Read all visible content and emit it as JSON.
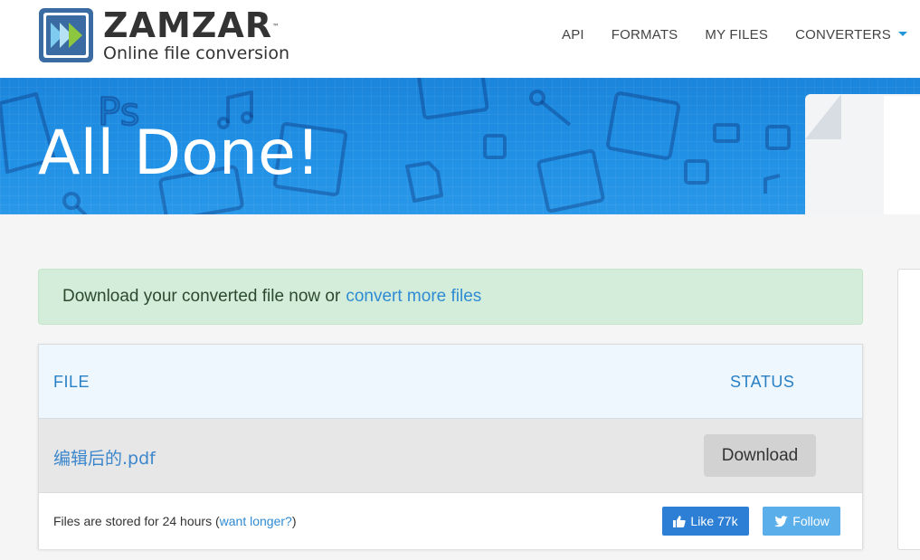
{
  "brand": {
    "name": "ZAMZAR",
    "trademark": "™",
    "tagline": "Online file conversion",
    "colors": {
      "badge_bg": "#3a6ca3",
      "arrow_light": "#7ecbef",
      "arrow_green": "#8dc63f"
    }
  },
  "nav": {
    "items": [
      {
        "label": "API"
      },
      {
        "label": "FORMATS"
      },
      {
        "label": "MY FILES"
      },
      {
        "label": "CONVERTERS"
      }
    ],
    "dropdown_icon": "caret-down-icon"
  },
  "banner": {
    "title": "All Done!",
    "bg_color": "#1e8ce0"
  },
  "alert": {
    "text": "Download your converted file now or",
    "link": "convert more files",
    "bg_color": "#d4edda"
  },
  "files_table": {
    "headers": {
      "file": "FILE",
      "status": "STATUS"
    },
    "rows": [
      {
        "file_name": "编辑后的.pdf",
        "action": "Download"
      }
    ],
    "footer": {
      "storage_text": "Files are stored for 24 hours (",
      "storage_link": "want longer?",
      "storage_close": ")",
      "like_label": "Like 77k",
      "follow_label": "Follow"
    }
  }
}
